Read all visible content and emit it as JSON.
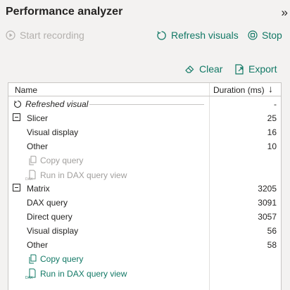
{
  "panel": {
    "title": "Performance analyzer",
    "collapse_glyph": "»"
  },
  "toolbar": {
    "start_recording": "Start recording",
    "refresh_visuals": "Refresh visuals",
    "stop": "Stop",
    "clear": "Clear",
    "export": "Export"
  },
  "table": {
    "col_name": "Name",
    "col_duration": "Duration (ms)",
    "sort_glyph": "↓",
    "refreshed_visual": {
      "label": "Refreshed visual",
      "duration": "-"
    },
    "slicer": {
      "label": "Slicer",
      "duration": "25",
      "children": [
        {
          "label": "Visual display",
          "duration": "16"
        },
        {
          "label": "Other",
          "duration": "10"
        }
      ],
      "copy_query": "Copy query",
      "run_dax": "Run in DAX query view"
    },
    "matrix": {
      "label": "Matrix",
      "duration": "3205",
      "children": [
        {
          "label": "DAX query",
          "duration": "3091"
        },
        {
          "label": "Direct query",
          "duration": "3057"
        },
        {
          "label": "Visual display",
          "duration": "56"
        },
        {
          "label": "Other",
          "duration": "58"
        }
      ],
      "copy_query": "Copy query",
      "run_dax": "Run in DAX query view"
    }
  },
  "colors": {
    "accent": "#117865",
    "disabled": "#b3b0ad",
    "text": "#252423"
  },
  "icons": {
    "start_recording": "record-icon",
    "refresh_visuals": "refresh-icon",
    "stop": "stop-icon",
    "clear": "eraser-icon",
    "export": "export-icon",
    "copy_query": "copy-icon",
    "run_dax": "dax-icon"
  }
}
